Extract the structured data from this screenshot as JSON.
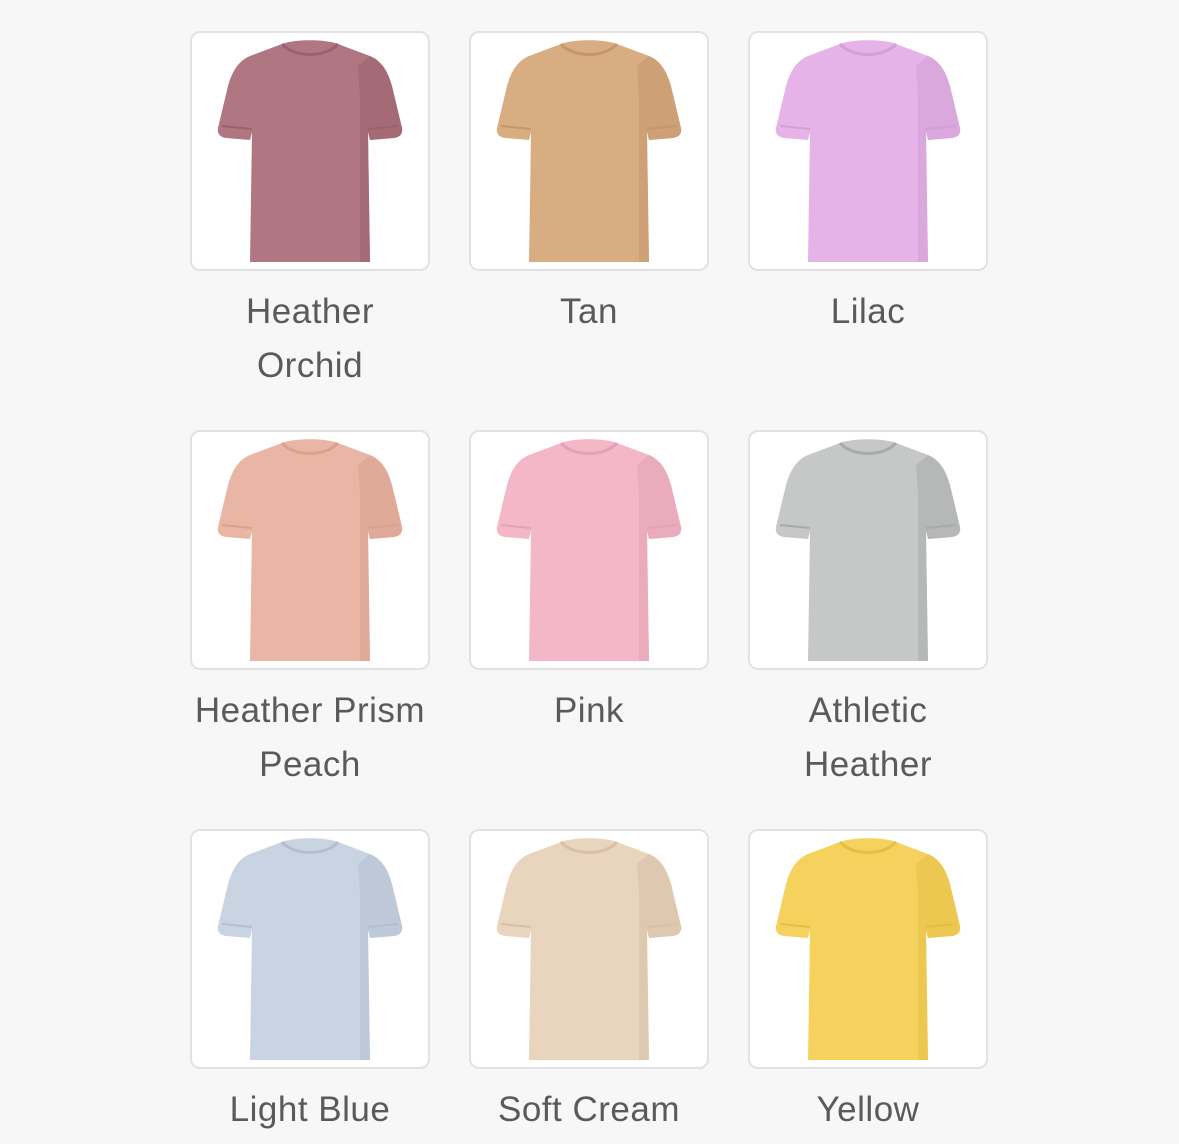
{
  "swatches": [
    {
      "name": "Heather Orchid",
      "color": "#b07682",
      "shade": "#9a6270"
    },
    {
      "name": "Tan",
      "color": "#d9ad82",
      "shade": "#c3966c"
    },
    {
      "name": "Lilac",
      "color": "#e5b3e8",
      "shade": "#d39fd6"
    },
    {
      "name": "Heather Prism Peach",
      "color": "#e9b5a5",
      "shade": "#d9a190"
    },
    {
      "name": "Pink",
      "color": "#f3b7c8",
      "shade": "#e2a2b5"
    },
    {
      "name": "Athletic Heather",
      "color": "#c6c8c7",
      "shade": "#a9abaa"
    },
    {
      "name": "Light Blue",
      "color": "#c9d4e3",
      "shade": "#b3bfd0"
    },
    {
      "name": "Soft Cream",
      "color": "#e9d5bd",
      "shade": "#d6c0a6"
    },
    {
      "name": "Yellow",
      "color": "#f5d25e",
      "shade": "#e4bf45"
    }
  ]
}
